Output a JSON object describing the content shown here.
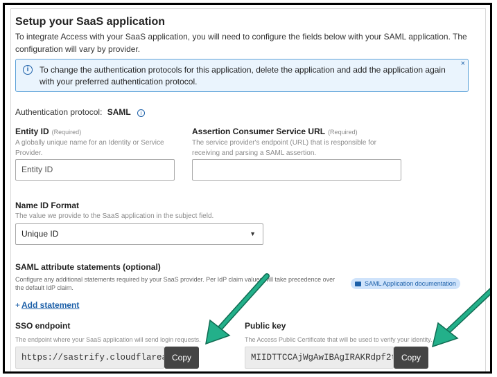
{
  "setup": {
    "title": "Setup your SaaS application",
    "intro": "To integrate Access with your SaaS application, you will need to configure the fields below with your SAML application. The configuration will vary by provider."
  },
  "info_banner": {
    "icon": "info-icon",
    "text": "To change the authentication protocols for this application, delete the application and add the application again with your preferred authentication protocol.",
    "close_symbol": "×"
  },
  "auth_protocol": {
    "label": "Authentication protocol:",
    "value": "SAML"
  },
  "entity_id": {
    "label": "Entity ID",
    "required": "(Required)",
    "help": "A globally unique name for an Identity or Service Provider.",
    "placeholder": "Entity ID"
  },
  "acs_url": {
    "label": "Assertion Consumer Service URL",
    "required": "(Required)",
    "help": "The service provider's endpoint (URL) that is responsible for receiving and parsing a SAML assertion.",
    "placeholder": ""
  },
  "name_id": {
    "label": "Name ID Format",
    "help": "The value we provide to the SaaS application in the subject field.",
    "selected": "Unique ID"
  },
  "saml_attrs": {
    "label": "SAML attribute statements (optional)",
    "help": "Configure any additional statements required by your SaaS provider. Per IdP claim values will take precedence over the default IdP claim.",
    "doc_link": "SAML Application documentation",
    "add_plus": "+",
    "add_label": "Add statement"
  },
  "sso": {
    "label": "SSO endpoint",
    "help": "The endpoint where your SaaS application will send login requests.",
    "value": "https://sastrify.cloudflarea…",
    "copy": "Copy"
  },
  "public_key": {
    "label": "Public key",
    "help": "The Access Public Certificate that will be used to verify your identity.",
    "value": "MIIDTTCCAjWgAwIBAgIRAKRdpf2t…",
    "copy": "Copy"
  },
  "colors": {
    "accent": "#1b5fa8",
    "banner_bg": "#eaf4fd",
    "arrow": "#23b08a"
  }
}
